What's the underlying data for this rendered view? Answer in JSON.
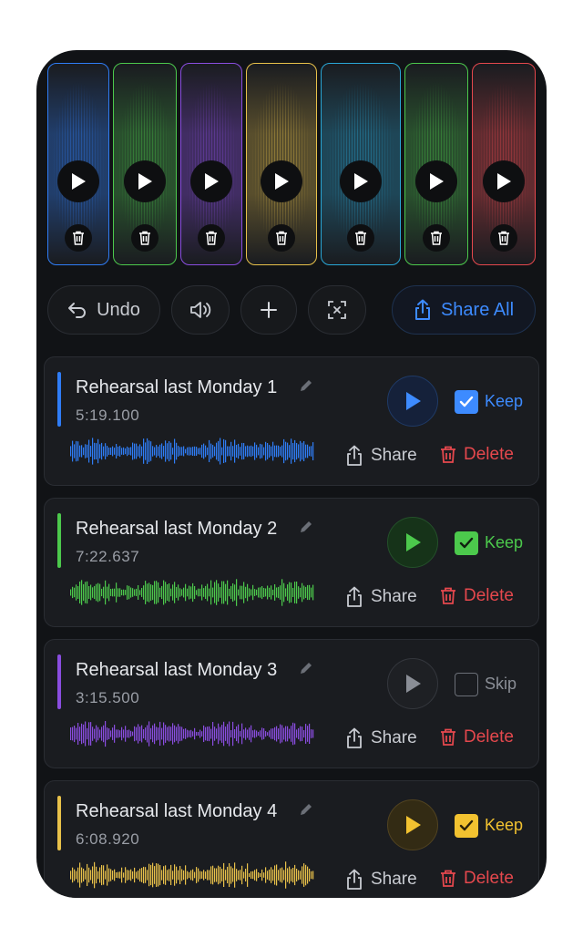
{
  "colors": {
    "blue": "#2f7df6",
    "green": "#4cc94c",
    "purple": "#8a4de0",
    "gold": "#e8c14a",
    "cyan": "#29a7d6",
    "red": "#e5484d",
    "share_accent": "#3d8bff",
    "background": "#111316"
  },
  "clips": [
    {
      "color": "#2f7df6",
      "play_icon": "play-icon",
      "delete_icon": "trash-icon"
    },
    {
      "color": "#4cc94c",
      "play_icon": "play-icon",
      "delete_icon": "trash-icon"
    },
    {
      "color": "#8a4de0",
      "play_icon": "play-icon",
      "delete_icon": "trash-icon"
    },
    {
      "color": "#e8c14a",
      "play_icon": "play-icon",
      "delete_icon": "trash-icon"
    },
    {
      "color": "#29a7d6",
      "play_icon": "play-icon",
      "delete_icon": "trash-icon"
    },
    {
      "color": "#4cc94c",
      "play_icon": "play-icon",
      "delete_icon": "trash-icon"
    },
    {
      "color": "#e5484d",
      "play_icon": "play-icon",
      "delete_icon": "trash-icon"
    }
  ],
  "toolbar": {
    "undo_label": "Undo",
    "undo_icon": "undo-icon",
    "volume_icon": "speaker-icon",
    "add_icon": "plus-icon",
    "fit_icon": "crop-x-icon",
    "share_all_label": "Share All",
    "share_all_icon": "share-icon"
  },
  "recordings": [
    {
      "title": "Rehearsal last Monday 1",
      "duration": "5:19.100",
      "color": "#2f7df6",
      "checked": true,
      "status": "Keep",
      "share_label": "Share",
      "delete_label": "Delete"
    },
    {
      "title": "Rehearsal last Monday 2",
      "duration": "7:22.637",
      "color": "#4cc94c",
      "checked": true,
      "status": "Keep",
      "share_label": "Share",
      "delete_label": "Delete"
    },
    {
      "title": "Rehearsal last Monday 3",
      "duration": "3:15.500",
      "color": "#8a4de0",
      "checked": false,
      "status": "Skip",
      "share_label": "Share",
      "delete_label": "Delete"
    },
    {
      "title": "Rehearsal last Monday 4",
      "duration": "6:08.920",
      "color": "#e8c14a",
      "checked": true,
      "status": "Keep",
      "share_label": "Share",
      "delete_label": "Delete"
    }
  ]
}
